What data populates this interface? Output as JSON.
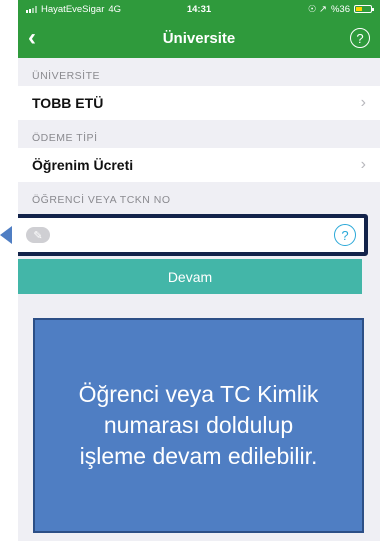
{
  "status_bar": {
    "carrier": "HayatEveSigar",
    "network": "4G",
    "time": "14:31",
    "icons": "☉ ↗",
    "battery_text": "%36",
    "battery_level": 0.36
  },
  "navbar": {
    "back_icon": "back-chevron-icon",
    "title": "Üniversite",
    "help_icon": "help-circle-icon",
    "help_glyph": "?"
  },
  "form": {
    "university_label": "ÜNİVERSİTE",
    "university_value": "TOBB ETÜ",
    "payment_label": "ÖDEME TİPİ",
    "payment_value": "Öğrenim Ücreti",
    "chevron": "›",
    "tckn_label": "ÖĞRENCİ VEYA TCKN NO",
    "tckn_value": "",
    "tckn_help": "?"
  },
  "actions": {
    "continue_label": "Devam"
  },
  "callout": {
    "text": "Öğrenci veya TC Kimlik numarası doldulup işleme devam edilebilir."
  },
  "colors": {
    "header_green": "#2f9a3c",
    "button_teal": "#43b6a8",
    "callout_blue": "#4f7ec3",
    "highlight_border": "#13234a"
  }
}
